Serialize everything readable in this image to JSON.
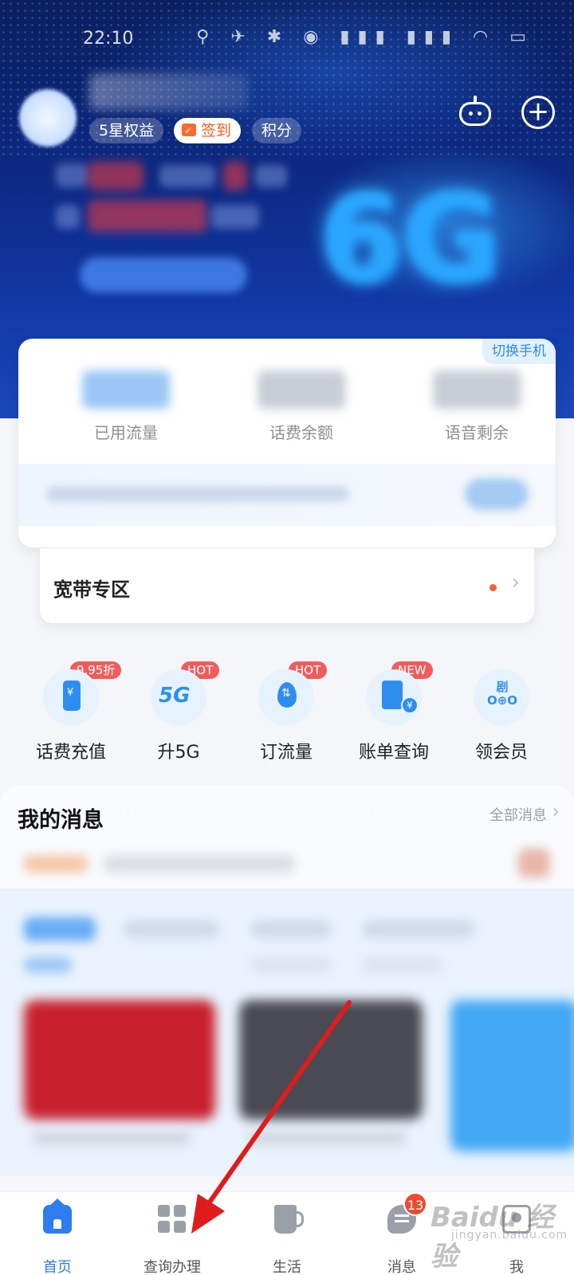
{
  "status_bar": {
    "time": "22:10",
    "icons": "⚲ ✈ ✱ ◉ ▮▮▮ ▮▮▮ ◠ ▭"
  },
  "header": {
    "stars_label": "5星权益",
    "sign_label": "签到",
    "points_label": "积分",
    "robot_icon": "robot-icon",
    "plus_icon": "plus-icon",
    "plus_glyph": "+"
  },
  "data_card": {
    "switch_label": "切换手机",
    "stats": [
      {
        "label": "已用流量"
      },
      {
        "label": "话费余额"
      },
      {
        "label": "语音剩余"
      }
    ]
  },
  "broadband": {
    "title": "宽带专区",
    "chevron": "›"
  },
  "actions": [
    {
      "label": "话费充值",
      "tag": "9.95折",
      "icon": "recharge-icon"
    },
    {
      "label": "升5G",
      "tag": "HOT",
      "icon": "5g-icon",
      "icon_text": "5G"
    },
    {
      "label": "订流量",
      "tag": "HOT",
      "icon": "data-drop-icon"
    },
    {
      "label": "账单查询",
      "tag": "NEW",
      "icon": "bill-icon"
    },
    {
      "label": "领会员",
      "tag": "",
      "icon": "vip-icon",
      "icon_text": "剧\nO⊕O"
    }
  ],
  "messages": {
    "title": "我的消息",
    "all_label": "全部消息",
    "chevron": "›"
  },
  "bottom_nav": [
    {
      "label": "首页",
      "active": true
    },
    {
      "label": "查询办理",
      "active": false
    },
    {
      "label": "生活",
      "active": false
    },
    {
      "label": "消息",
      "active": false,
      "badge": "13"
    },
    {
      "label": "我",
      "active": false
    }
  ],
  "watermark": {
    "text": "Baidu 经验",
    "sub": "jingyan.baidu.com"
  },
  "colors": {
    "accent": "#2e7df0",
    "hot_tag": "#f25b5b",
    "sign": "#ff5a1f",
    "annotation_arrow": "#e01b1b"
  }
}
